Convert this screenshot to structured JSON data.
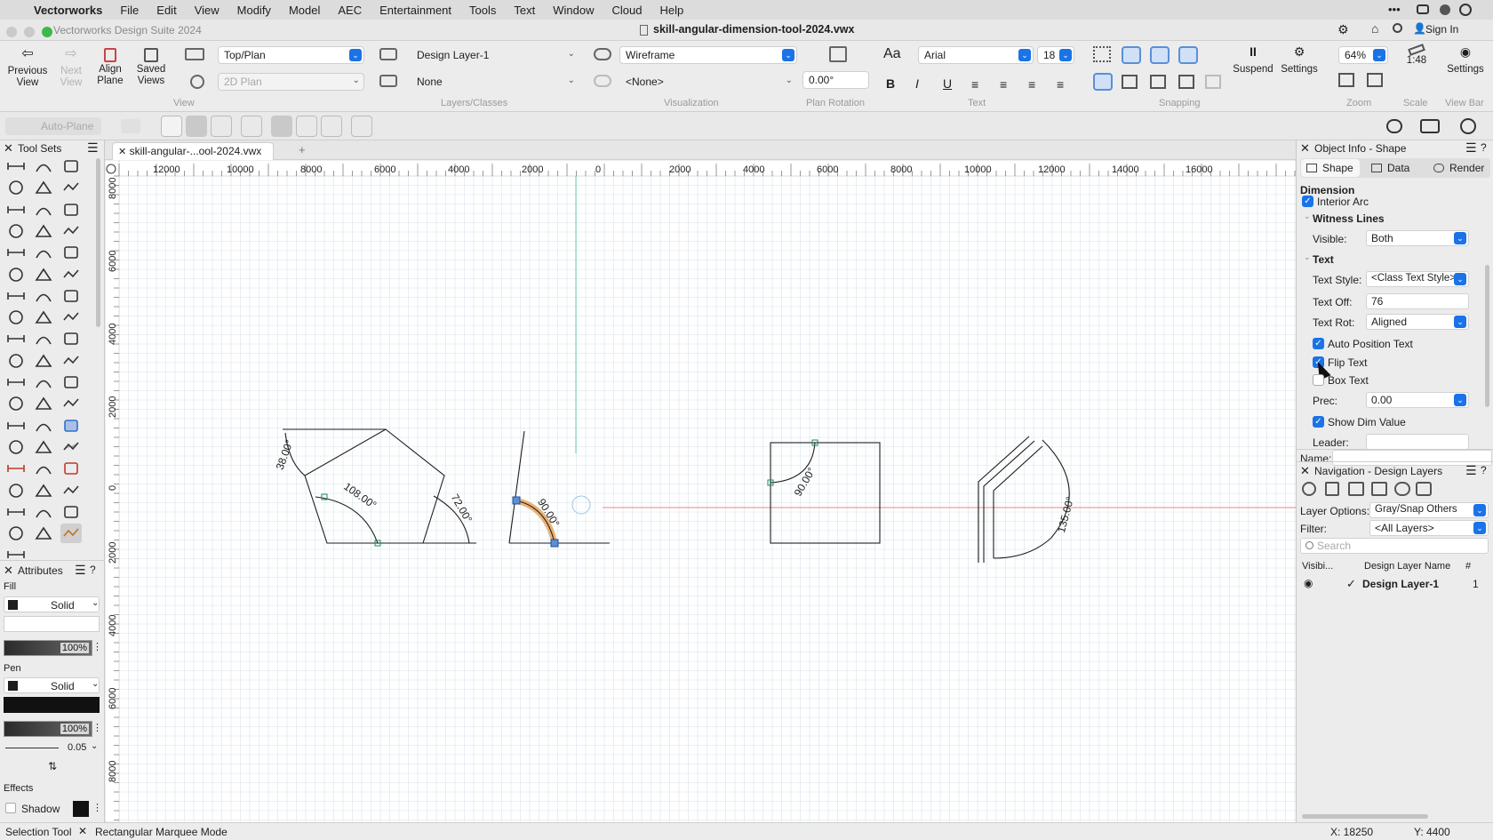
{
  "menubar": {
    "app_name": "Vectorworks",
    "items": [
      "File",
      "Edit",
      "View",
      "Modify",
      "Model",
      "AEC",
      "Entertainment",
      "Tools",
      "Text",
      "Window",
      "Cloud",
      "Help"
    ]
  },
  "titlebar": {
    "app_title": "Vectorworks Design Suite 2024",
    "doc_title": "skill-angular-dimension-tool-2024.vwx",
    "sign_in": "Sign In"
  },
  "toolbar": {
    "previous_view": "Previous View",
    "next_view": "Next View",
    "align_plane": "Align Plane",
    "saved_views": "Saved Views",
    "view_select": "Top/Plan",
    "plan_select": "2D Plan",
    "layer_select": "Design Layer-1",
    "class_select": "None",
    "render_select": "Wireframe",
    "vis_select": "<None>",
    "plan_rotation": "0.00°",
    "font_select": "Arial",
    "font_size": "18",
    "suspend": "Suspend",
    "settings": "Settings",
    "zoom_value": "64%",
    "scale_value": "1:48",
    "settings2": "Settings",
    "groups": {
      "view": "View",
      "layers_classes": "Layers/Classes",
      "visualization": "Visualization",
      "plan_rotation": "Plan Rotation",
      "text": "Text",
      "snapping": "Snapping",
      "zoom": "Zoom",
      "scale": "Scale",
      "view_bar": "View Bar"
    }
  },
  "toolbar2": {
    "auto_plane": "Auto-Plane"
  },
  "tool_sets": {
    "title": "Tool Sets"
  },
  "attributes": {
    "title": "Attributes",
    "fill_label": "Fill",
    "fill_style": "Solid",
    "fill_opacity": "100%",
    "pen_label": "Pen",
    "pen_style": "Solid",
    "pen_opacity": "100%",
    "line_weight": "0.05",
    "effects_label": "Effects",
    "shadow_label": "Shadow"
  },
  "document": {
    "tab_label": "skill-angular-...ool-2024.vwx",
    "h_ruler": [
      "12000",
      "10000",
      "8000",
      "6000",
      "4000",
      "2000",
      "0",
      "2000",
      "4000",
      "6000",
      "8000",
      "10000",
      "12000",
      "14000",
      "16000"
    ],
    "v_ruler": [
      "8000",
      "6000",
      "4000",
      "2000",
      "0",
      "2000",
      "4000",
      "6000",
      "8000"
    ]
  },
  "drawing": {
    "dim_pent_left": "38.00°",
    "dim_pent_inner": "108.00°",
    "dim_pent_right": "72.00°",
    "dim_selected": "90.00°",
    "dim_square": "90.00°",
    "dim_arc": "135.00°"
  },
  "object_info": {
    "title": "Object Info - Shape",
    "tabs": [
      "Shape",
      "Data",
      "Render"
    ],
    "section_dimension": "Dimension",
    "interior_arc": "Interior Arc",
    "witness_lines": "Witness Lines",
    "visible_label": "Visible:",
    "visible_value": "Both",
    "text_section": "Text",
    "text_style_label": "Text Style:",
    "text_style_value": "<Class Text Style>",
    "text_off_label": "Text Off:",
    "text_off_value": "76",
    "text_rot_label": "Text Rot:",
    "text_rot_value": "Aligned",
    "auto_position_text": "Auto Position Text",
    "flip_text": "Flip Text",
    "box_text": "Box Text",
    "prec_label": "Prec:",
    "prec_value": "0.00",
    "show_dim_value": "Show Dim Value",
    "leader_label": "Leader:",
    "name_label": "Name:"
  },
  "navigation": {
    "title": "Navigation - Design Layers",
    "layer_options_label": "Layer Options:",
    "layer_options_value": "Gray/Snap Others",
    "filter_label": "Filter:",
    "filter_value": "<All Layers>",
    "search_placeholder": "Search",
    "col_visibility": "Visibi...",
    "col_name": "Design Layer Name",
    "col_num": "#",
    "layer_name": "Design Layer-1",
    "layer_num": "1"
  },
  "status": {
    "tool": "Selection Tool",
    "mode": "Rectangular Marquee Mode",
    "x": "X: 18250",
    "y": "Y: 4400"
  }
}
